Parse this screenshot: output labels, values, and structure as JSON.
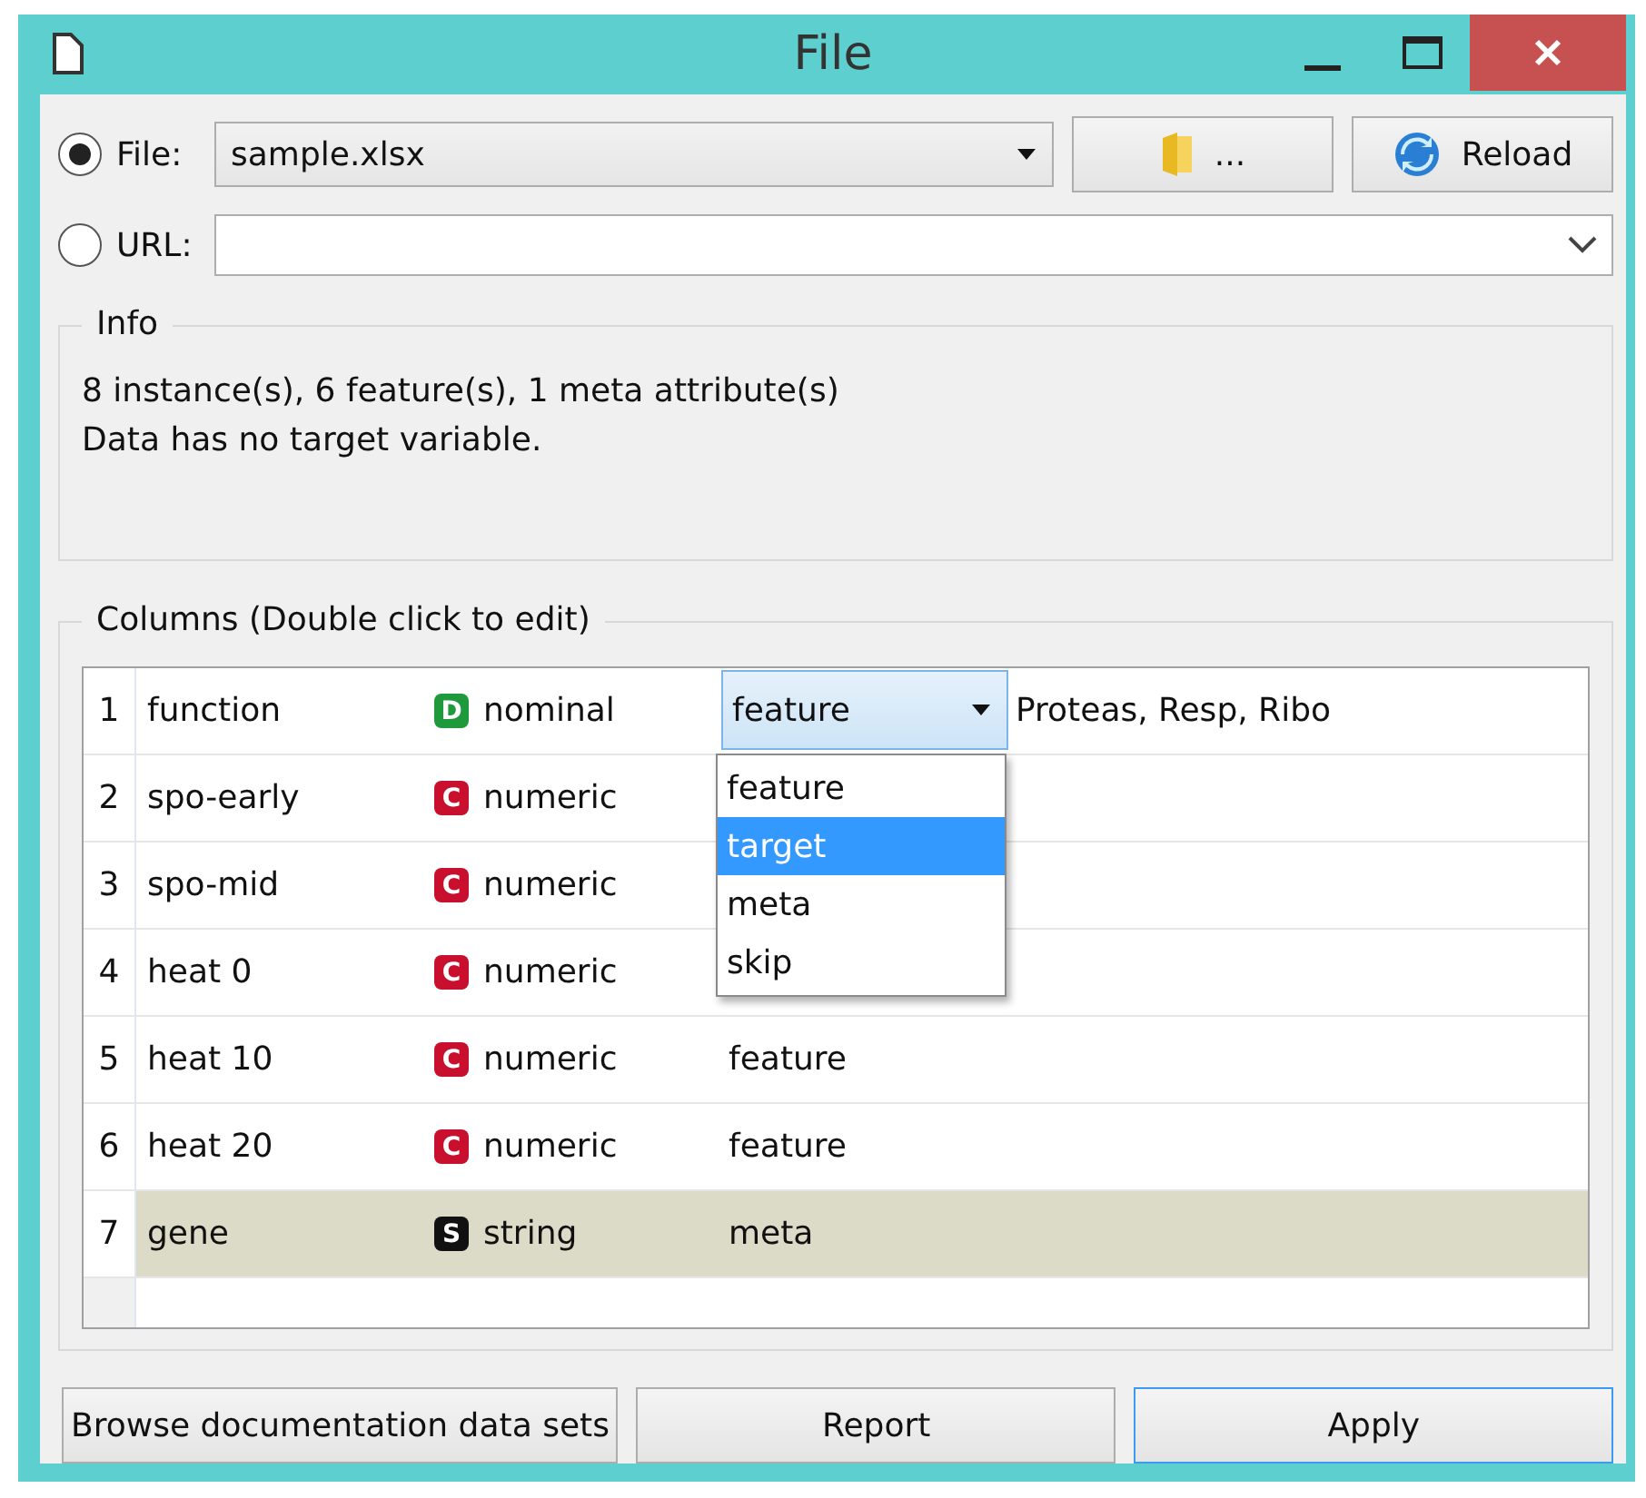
{
  "window": {
    "title": "File"
  },
  "source": [
    {
      "label": "File:",
      "selected": true,
      "value": "sample.xlsx"
    },
    {
      "label": "URL:",
      "selected": false
    }
  ],
  "file_buttons": [
    {
      "kind": "browse",
      "label": "..."
    },
    {
      "kind": "reload",
      "label": "Reload"
    }
  ],
  "info": {
    "title": "Info",
    "lines": [
      "8 instance(s), 6 feature(s), 1 meta attribute(s)",
      "Data has no target variable."
    ]
  },
  "columns": {
    "title": "Columns (Double click to edit)",
    "rows": [
      {
        "index": "1",
        "name": "function",
        "badge": "D",
        "color": "#1e9a3c",
        "type": "nominal",
        "role": "feature",
        "editing": true,
        "values": "Proteas, Resp, Ribo",
        "selected": false
      },
      {
        "index": "2",
        "name": "spo-early",
        "badge": "C",
        "color": "#c8102e",
        "type": "numeric",
        "editing": false,
        "selected": false
      },
      {
        "index": "3",
        "name": "spo-mid",
        "badge": "C",
        "color": "#c8102e",
        "type": "numeric",
        "editing": false,
        "selected": false
      },
      {
        "index": "4",
        "name": "heat 0",
        "badge": "C",
        "color": "#c8102e",
        "type": "numeric",
        "editing": false,
        "selected": false
      },
      {
        "index": "5",
        "name": "heat 10",
        "badge": "C",
        "color": "#c8102e",
        "type": "numeric",
        "role": "feature",
        "editing": false,
        "selected": false
      },
      {
        "index": "6",
        "name": "heat 20",
        "badge": "C",
        "color": "#c8102e",
        "type": "numeric",
        "role": "feature",
        "editing": false,
        "selected": false
      },
      {
        "index": "7",
        "name": "gene",
        "badge": "S",
        "color": "#111111",
        "type": "string",
        "role": "meta",
        "editing": false,
        "selected": true
      }
    ]
  },
  "role_menu": [
    {
      "label": "feature",
      "selected": false
    },
    {
      "label": "target",
      "selected": true
    },
    {
      "label": "meta",
      "selected": false
    },
    {
      "label": "skip",
      "selected": false
    }
  ],
  "buttons": [
    {
      "label": "Browse documentation data sets",
      "kind": "normal"
    },
    {
      "label": "Report",
      "kind": "normal"
    },
    {
      "label": "Apply",
      "kind": "default"
    }
  ]
}
